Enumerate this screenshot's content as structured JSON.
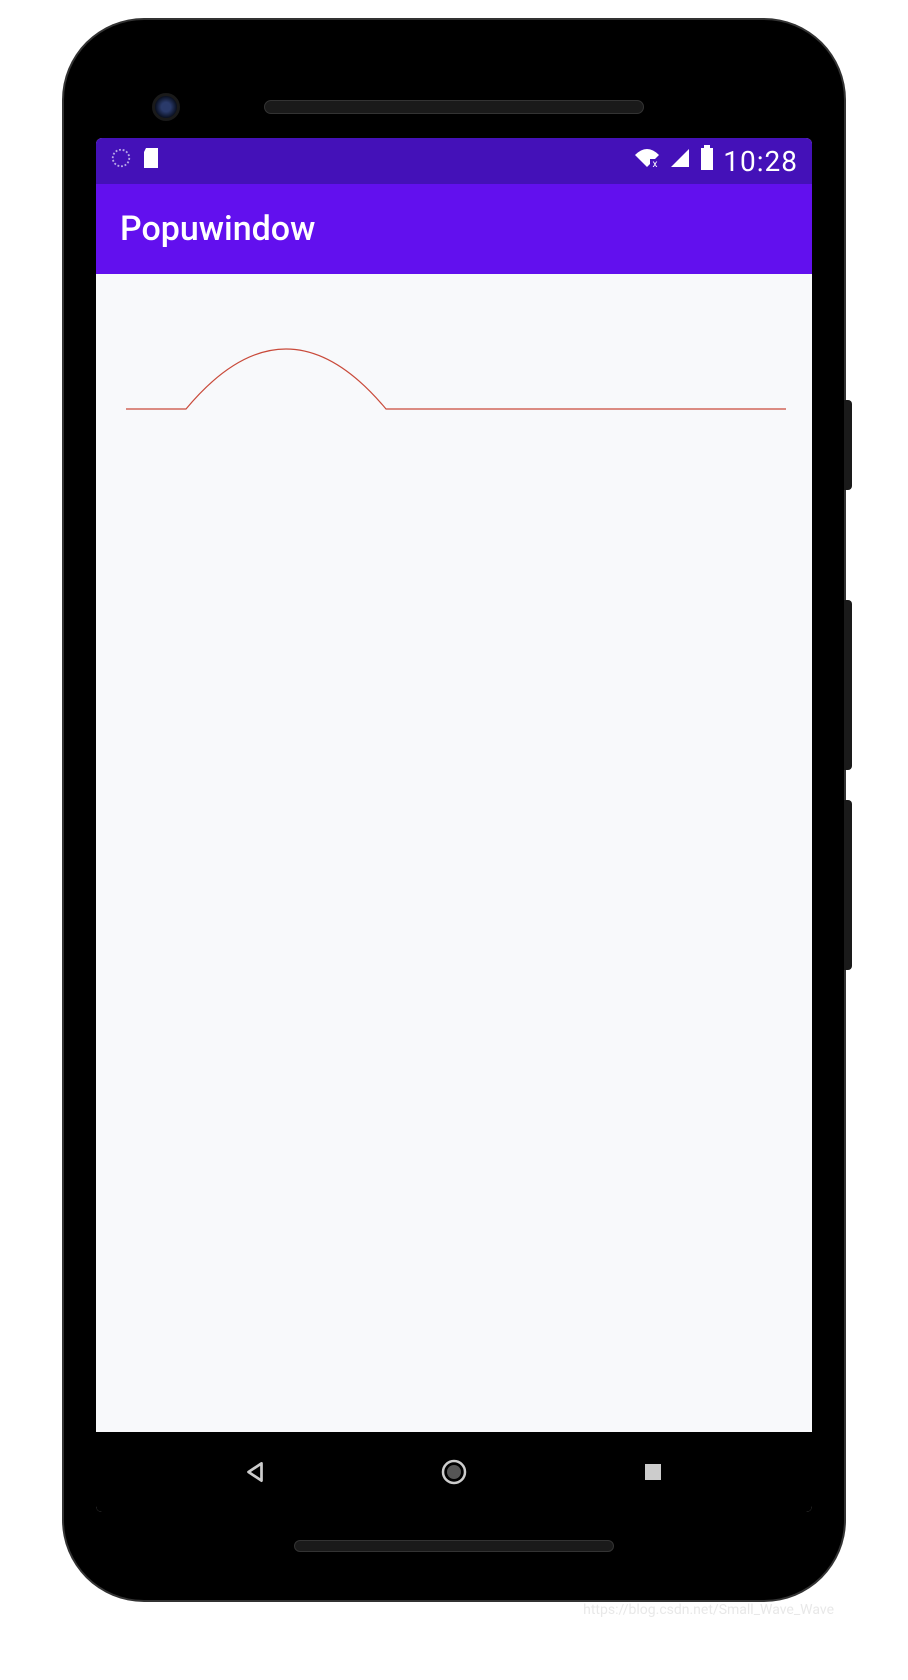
{
  "status_bar": {
    "time": "10:28",
    "icons": {
      "circle": "circle-icon",
      "sd_card": "sd-card-icon",
      "wifi": "wifi-no-internet-icon",
      "signal": "cell-signal-icon",
      "battery": "battery-full-icon"
    }
  },
  "app_bar": {
    "title": "Popuwindow"
  },
  "content": {
    "curve_stroke": "#c94a3a"
  },
  "nav_bar": {
    "back": "back-icon",
    "home": "home-icon",
    "recent": "recent-icon"
  },
  "watermark": "https://blog.csdn.net/Small_Wave_Wave"
}
